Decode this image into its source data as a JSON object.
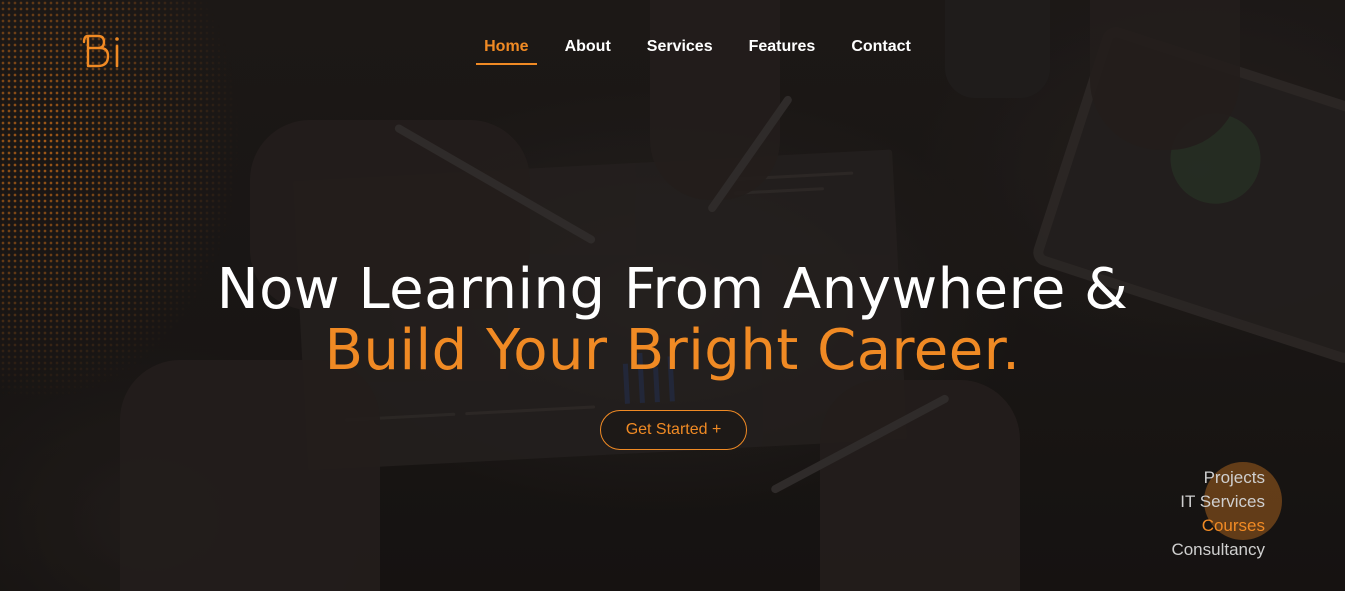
{
  "colors": {
    "accent": "#f08a24",
    "text_primary": "#ffffff",
    "text_muted": "#cfcfcf",
    "background": "#1d1a18"
  },
  "header": {
    "logo_icon": "bi-logo-icon",
    "nav": [
      {
        "label": "Home",
        "active": true
      },
      {
        "label": "About",
        "active": false
      },
      {
        "label": "Services",
        "active": false
      },
      {
        "label": "Features",
        "active": false
      },
      {
        "label": "Contact",
        "active": false
      }
    ]
  },
  "hero": {
    "headline_line1": "Now Learning From Anywhere &",
    "headline_line2": "Build Your Bright Career.",
    "cta_label": "Get Started +"
  },
  "side_menu": {
    "items": [
      {
        "label": "Projects",
        "active": false
      },
      {
        "label": "IT Services",
        "active": false
      },
      {
        "label": "Courses",
        "active": true
      },
      {
        "label": "Consultancy",
        "active": false
      }
    ]
  }
}
